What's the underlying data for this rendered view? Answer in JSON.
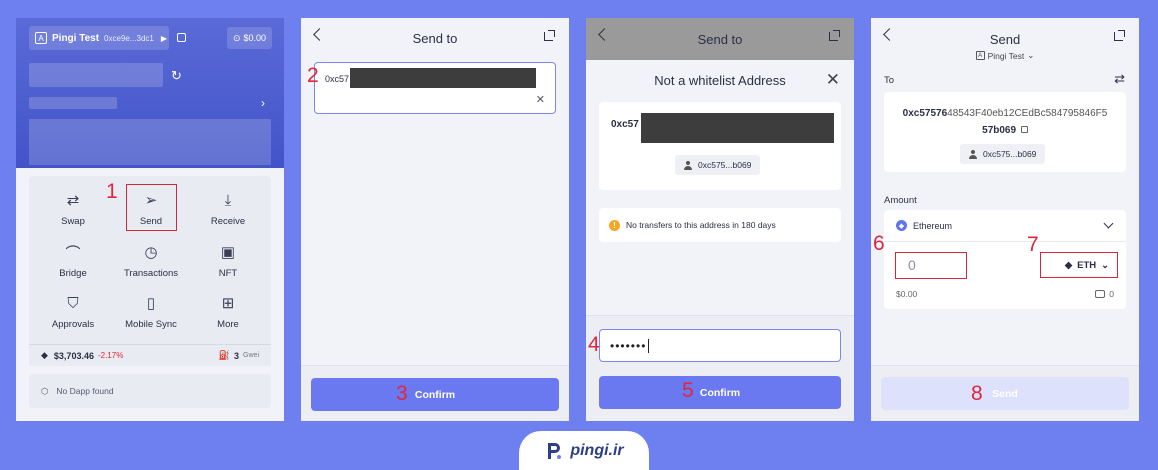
{
  "panel1": {
    "account_name": "Pingi Test",
    "account_badge": "A",
    "account_address": "0xce9e...3dc1",
    "balance": "$0.00",
    "actions": [
      {
        "label": "Swap",
        "icon": "swap-icon"
      },
      {
        "label": "Send",
        "icon": "send-icon"
      },
      {
        "label": "Receive",
        "icon": "receive-icon"
      },
      {
        "label": "Bridge",
        "icon": "bridge-icon"
      },
      {
        "label": "Transactions",
        "icon": "clock-icon"
      },
      {
        "label": "NFT",
        "icon": "nft-icon"
      },
      {
        "label": "Approvals",
        "icon": "shield-icon"
      },
      {
        "label": "Mobile Sync",
        "icon": "mobile-icon"
      },
      {
        "label": "More",
        "icon": "grid-icon"
      }
    ],
    "eth_price": "$3,703.46",
    "eth_change": "-2.17%",
    "gas_value": "3",
    "gas_unit": "Gwei",
    "dapp_text": "No Dapp found"
  },
  "panel2": {
    "title": "Send to",
    "address_prefix": "0xc57",
    "confirm_label": "Confirm"
  },
  "panel3": {
    "title": "Send to",
    "modal_title": "Not a whitelist Address",
    "address_prefix": "0xc57",
    "address_short": "0xc575...b069",
    "warning": "No transfers to this address in 180 days",
    "password_mask": "•••••••",
    "confirm_label": "Confirm"
  },
  "panel4": {
    "title": "Send",
    "account": "Pingi Test",
    "account_badge": "A",
    "to_label": "To",
    "to_address_bold": "0xc57576",
    "to_address_rest": "48543F40eb12CEdBc584795846F5",
    "to_address_tail": "57b069",
    "address_short": "0xc575...b069",
    "amount_label": "Amount",
    "asset": "Ethereum",
    "amount_value": "0",
    "token": "ETH",
    "usd_value": "$0.00",
    "wallet_balance": "0",
    "send_label": "Send"
  },
  "steps": [
    "1",
    "2",
    "3",
    "4",
    "5",
    "6",
    "7",
    "8"
  ],
  "logo": {
    "text": "pingi.ir"
  },
  "colors": {
    "background": "#6e7ff0",
    "accent": "#6b79f0",
    "annotation": "#e0263a"
  }
}
